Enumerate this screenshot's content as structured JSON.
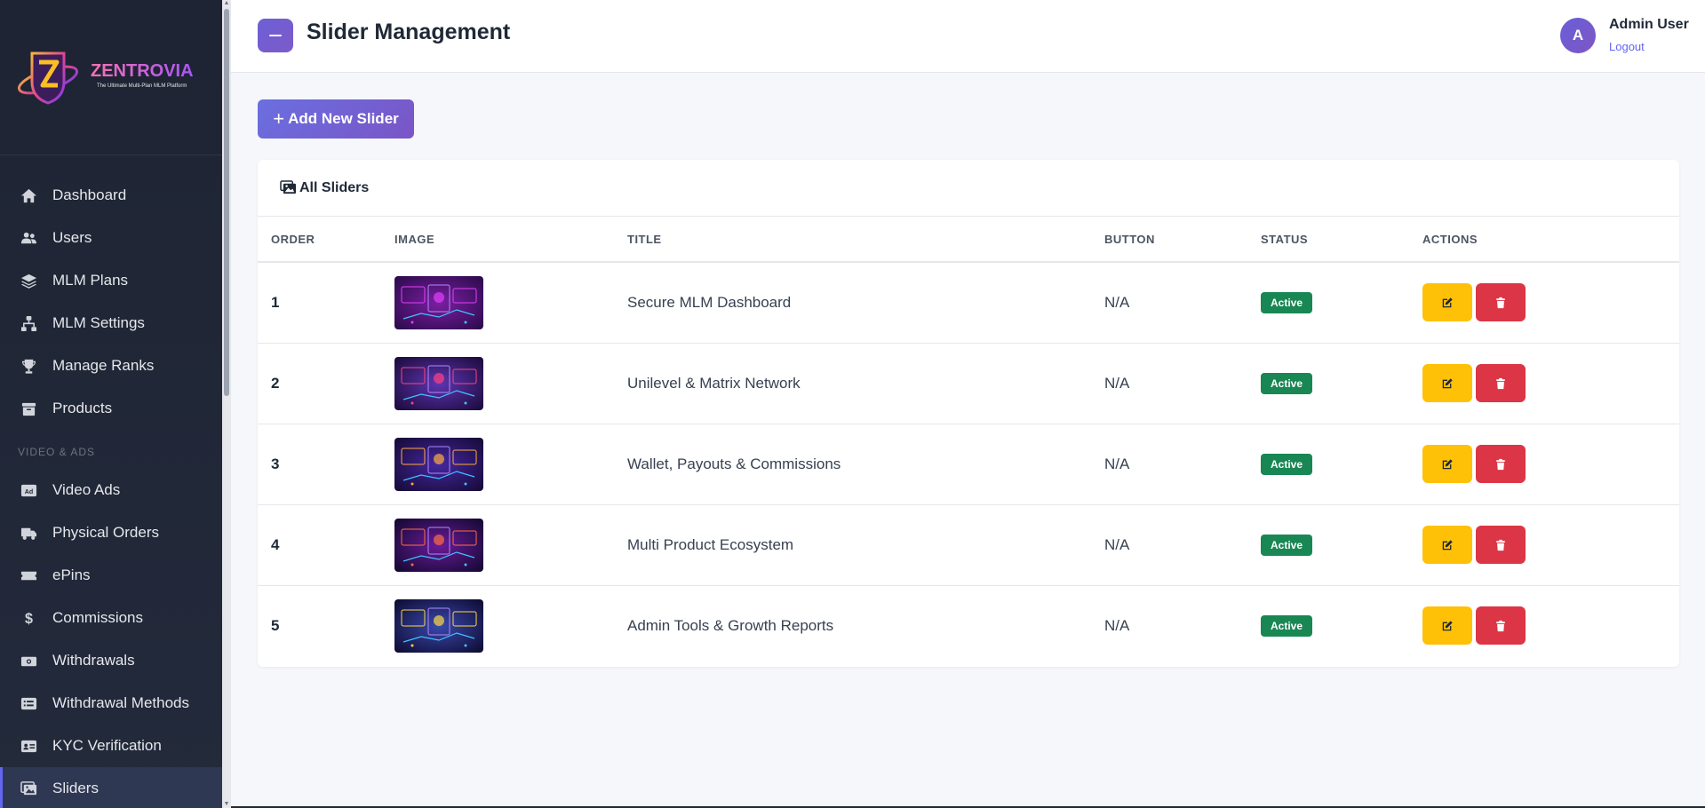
{
  "brand": {
    "name": "ZENTROVIA",
    "tagline": "The Ultimate Multi-Plan MLM Platform"
  },
  "sidebar": {
    "items_top": [
      {
        "label": "Dashboard",
        "icon": "home-icon"
      },
      {
        "label": "Users",
        "icon": "users-icon"
      },
      {
        "label": "MLM Plans",
        "icon": "layers-icon"
      },
      {
        "label": "MLM Settings",
        "icon": "sitemap-icon"
      },
      {
        "label": "Manage Ranks",
        "icon": "trophy-icon"
      },
      {
        "label": "Products",
        "icon": "box-icon"
      }
    ],
    "section_label": "VIDEO & ADS",
    "items_bottom": [
      {
        "label": "Video Ads",
        "icon": "ad-icon"
      },
      {
        "label": "Physical Orders",
        "icon": "truck-icon"
      },
      {
        "label": "ePins",
        "icon": "ticket-icon"
      },
      {
        "label": "Commissions",
        "icon": "dollar-icon"
      },
      {
        "label": "Withdrawals",
        "icon": "money-icon"
      },
      {
        "label": "Withdrawal Methods",
        "icon": "list-card-icon"
      },
      {
        "label": "KYC Verification",
        "icon": "id-card-icon"
      },
      {
        "label": "Sliders",
        "icon": "images-icon"
      }
    ]
  },
  "header": {
    "title": "Slider Management",
    "user_initial": "A",
    "user_name": "Admin User",
    "logout_label": "Logout"
  },
  "main": {
    "add_button_label": "Add New Slider",
    "card_title": "All Sliders",
    "columns": [
      "ORDER",
      "IMAGE",
      "TITLE",
      "BUTTON",
      "STATUS",
      "ACTIONS"
    ],
    "rows": [
      {
        "order": "1",
        "title": "Secure MLM Dashboard",
        "button": "N/A",
        "status": "Active"
      },
      {
        "order": "2",
        "title": "Unilevel & Matrix Network",
        "button": "N/A",
        "status": "Active"
      },
      {
        "order": "3",
        "title": "Wallet, Payouts & Commissions",
        "button": "N/A",
        "status": "Active"
      },
      {
        "order": "4",
        "title": "Multi Product Ecosystem",
        "button": "N/A",
        "status": "Active"
      },
      {
        "order": "5",
        "title": "Admin Tools & Growth Reports",
        "button": "N/A",
        "status": "Active"
      }
    ]
  },
  "colors": {
    "accent": "#6366f1",
    "sidebar_bg": "#1e2433",
    "status_active": "#198754",
    "edit": "#ffc107",
    "delete": "#dc3545"
  }
}
